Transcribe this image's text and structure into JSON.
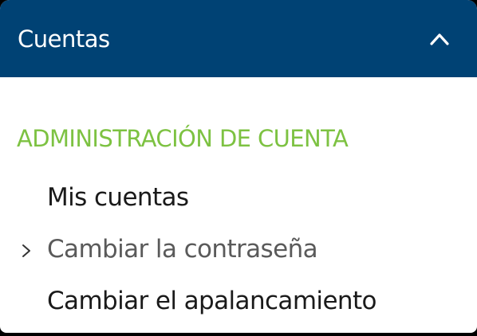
{
  "header": {
    "title": "Cuentas",
    "collapse_icon": "chevron-up-icon"
  },
  "section": {
    "title": "ADMINISTRACIÓN DE CUENTA"
  },
  "menu": {
    "items": [
      {
        "label": "Mis cuentas",
        "active": false
      },
      {
        "label": "Cambiar la contraseña",
        "active": true,
        "indicator_icon": "chevron-right-icon"
      },
      {
        "label": "Cambiar el apalancamiento",
        "active": false
      }
    ]
  },
  "colors": {
    "header_bg": "#004274",
    "section_title": "#7dc242",
    "text": "#1a1a1a",
    "active_text": "#5a5a5a"
  }
}
